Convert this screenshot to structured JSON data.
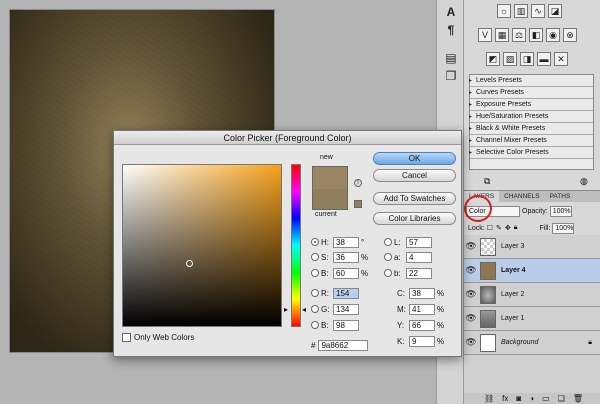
{
  "dialog": {
    "title": "Color Picker (Foreground Color)",
    "new_label": "new",
    "current_label": "current",
    "ok_label": "OK",
    "cancel_label": "Cancel",
    "add_swatches_label": "Add To Swatches",
    "color_libraries_label": "Color Libraries",
    "only_web_colors_label": "Only Web Colors",
    "new_color": "#9a8662",
    "current_color": "#8f7f5c",
    "fields": {
      "H": "38",
      "S": "36",
      "B": "60",
      "R": "154",
      "G": "134",
      "Bv": "98",
      "L": "57",
      "a": "4",
      "b": "22",
      "C": "38",
      "M": "41",
      "Y": "66",
      "K": "9"
    },
    "units": {
      "deg": "°",
      "pct": "%"
    },
    "labels": {
      "H": "H:",
      "S": "S:",
      "B": "B:",
      "R": "R:",
      "G": "G:",
      "Bv": "B:",
      "L": "L:",
      "a": "a:",
      "b": "b:",
      "C": "C:",
      "M": "M:",
      "Y": "Y:",
      "K": "K:"
    },
    "hex_prefix": "#",
    "hex_value": "9a8662"
  },
  "presets": [
    "Levels Presets",
    "Curves Presets",
    "Exposure Presets",
    "Hue/Saturation Presets",
    "Black & White Presets",
    "Channel Mixer Presets",
    "Selective Color Presets"
  ],
  "layers_panel": {
    "tabs": [
      "LAYERS",
      "CHANNELS",
      "PATHS"
    ],
    "blend_mode": "Color",
    "opacity_label": "Opacity:",
    "opacity_value": "100%",
    "lock_label": "Lock:",
    "fill_label": "Fill:",
    "fill_value": "100%",
    "layers": [
      {
        "name": "Layer 3",
        "selected": false
      },
      {
        "name": "Layer 4",
        "selected": true
      },
      {
        "name": "Layer 2",
        "selected": false
      },
      {
        "name": "Layer 1",
        "selected": false
      },
      {
        "name": "Background",
        "selected": false
      }
    ]
  },
  "strip_icons": [
    "type-icon",
    "paragraph-icon",
    "doc-icon",
    "clone-icon"
  ],
  "colors": {
    "hue_base": "#f6a11b",
    "highlight": "#d52020"
  }
}
